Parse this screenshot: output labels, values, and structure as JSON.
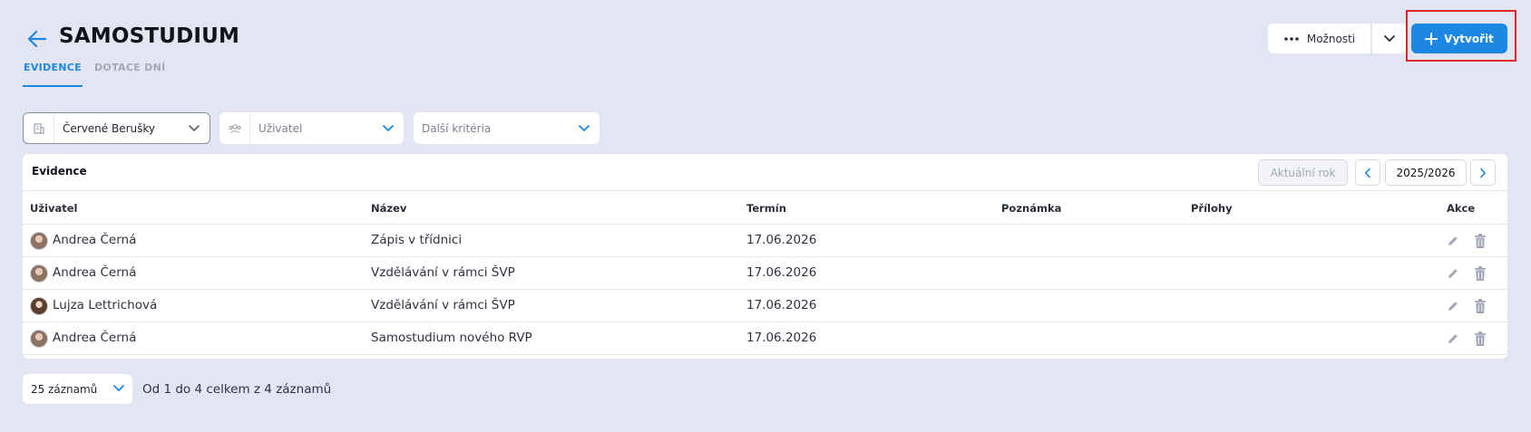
{
  "header": {
    "title": "SAMOSTUDIUM",
    "tabs": [
      {
        "label": "EVIDENCE",
        "active": true
      },
      {
        "label": "DOTACE DNÍ",
        "active": false
      }
    ],
    "options_label": "Možnosti",
    "create_label": "Vytvořit",
    "accent_color": "#1d87e4",
    "highlight_color": "#e3232b"
  },
  "filters": {
    "skupina_value": "Červené Berušky",
    "uzivatel_placeholder": "Uživatel",
    "dalsi_placeholder": "Další kritéria"
  },
  "evidence": {
    "title": "Evidence",
    "current_year_label": "Aktuální rok",
    "school_year": "2025/2026",
    "columns": [
      "Uživatel",
      "Název",
      "Termín",
      "Poznámka",
      "Přílohy",
      "Akce"
    ],
    "rows": [
      {
        "user": "Andrea Černá",
        "name": "Zápis v třídnici",
        "date": "17.06.2026",
        "note": "",
        "attachments": ""
      },
      {
        "user": "Andrea Černá",
        "name": "Vzdělávání v rámci ŠVP",
        "date": "17.06.2026",
        "note": "",
        "attachments": ""
      },
      {
        "user": "Lujza Lettrichová",
        "name": "Vzdělávání v rámci ŠVP",
        "date": "17.06.2026",
        "note": "",
        "attachments": ""
      },
      {
        "user": "Andrea Černá",
        "name": "Samostudium nového RVP",
        "date": "17.06.2026",
        "note": "",
        "attachments": ""
      }
    ]
  },
  "footer": {
    "page_size": "25 záznamů",
    "records_info": "Od 1 do 4 celkem z 4 záznamů"
  },
  "icons": [
    "arrow-left-icon",
    "dots-icon",
    "chevron-down-icon",
    "plus-icon",
    "building-icon",
    "users-icon",
    "chevron-left-icon",
    "chevron-right-icon",
    "avatar",
    "pencil-icon",
    "trash-icon"
  ]
}
